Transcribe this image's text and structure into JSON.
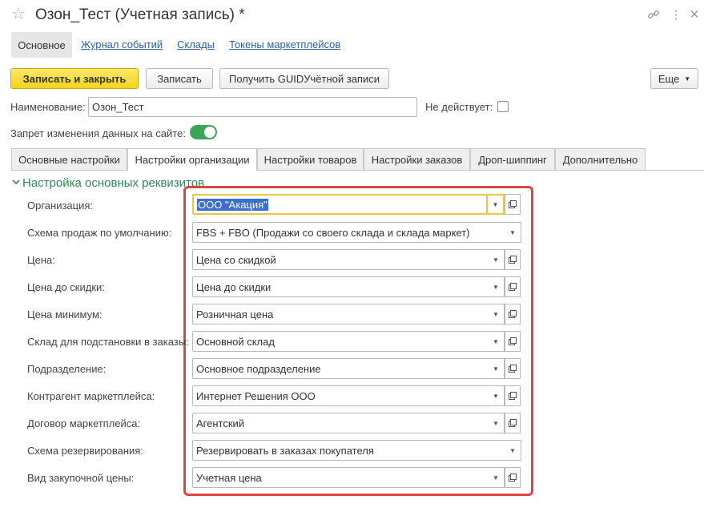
{
  "window": {
    "title": "Озон_Тест (Учетная запись) *",
    "star_icon": "star-icon",
    "link_icon": "link-icon",
    "menu_icon": "more-vertical-icon",
    "close_icon": "close-icon"
  },
  "nav": {
    "active": "Основное",
    "links": [
      "Журнал событий",
      "Склады",
      "Токены маркетплейсов"
    ]
  },
  "toolbar": {
    "save_close": "Записать и закрыть",
    "save": "Записать",
    "get_guid": "Получить GUIDУчётной записи",
    "more": "Еще",
    "help": "?"
  },
  "header_fields": {
    "name_label": "Наименование:",
    "name_value": "Озон_Тест",
    "inactive_label": "Не действует:",
    "inactive_checked": false,
    "lock_label": "Запрет изменения данных на сайте:",
    "lock_on": true
  },
  "tabs": [
    "Основные настройки",
    "Настройки организации",
    "Настройки товаров",
    "Настройки заказов",
    "Дроп-шиппинг",
    "Дополнительно"
  ],
  "active_tab": 1,
  "section": {
    "title": "Настройка основных реквизитов"
  },
  "form": {
    "org_label": "Организация:",
    "org_value": "ООО \"Акация\"",
    "scheme_label": "Схема продаж по умолчанию:",
    "scheme_value": "FBS + FBO (Продажи со своего склада и склада маркет)",
    "price_label": "Цена:",
    "price_value": "Цена со скидкой",
    "price_before_label": "Цена до скидки:",
    "price_before_value": "Цена до скидки",
    "price_min_label": "Цена минимум:",
    "price_min_value": "Розничная цена",
    "warehouse_label": "Склад для подстановки в заказы:",
    "warehouse_value": "Основной склад",
    "division_label": "Подразделение:",
    "division_value": "Основное подразделение",
    "counterparty_label": "Контрагент маркетплейса:",
    "counterparty_value": "Интернет Решения ООО",
    "contract_label": "Договор маркетплейса:",
    "contract_value": "Агентский",
    "reserve_label": "Схема резервирования:",
    "reserve_value": "Резервировать в заказах покупателя",
    "purchase_price_label": "Вид закупочной цены:",
    "purchase_price_value": "Учетная цена"
  },
  "colors": {
    "accent_green": "#2e8b57",
    "highlight_red": "#e04545",
    "primary_yellow": "#f3d31d",
    "link_blue": "#2a62a8"
  }
}
